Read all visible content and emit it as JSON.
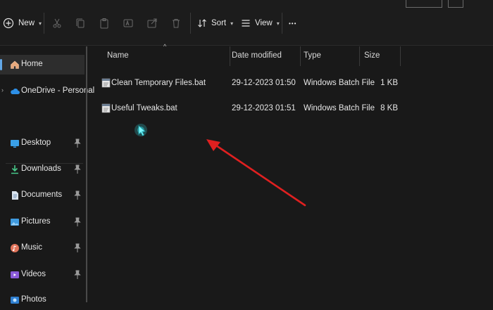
{
  "toolbar": {
    "new_label": "New",
    "sort_label": "Sort",
    "view_label": "View",
    "more_label": "•••"
  },
  "sidebar": {
    "items": [
      {
        "label": "Home",
        "icon": "home-icon"
      },
      {
        "label": "OneDrive - Personal",
        "icon": "cloud-icon"
      },
      {
        "label": "Desktop",
        "icon": "desktop-icon"
      },
      {
        "label": "Downloads",
        "icon": "download-icon"
      },
      {
        "label": "Documents",
        "icon": "documents-icon"
      },
      {
        "label": "Pictures",
        "icon": "pictures-icon"
      },
      {
        "label": "Music",
        "icon": "music-icon"
      },
      {
        "label": "Videos",
        "icon": "videos-icon"
      },
      {
        "label": "Photos",
        "icon": "photos-icon"
      }
    ]
  },
  "columns": {
    "name": "Name",
    "date": "Date modified",
    "type": "Type",
    "size": "Size"
  },
  "files": [
    {
      "name": "Clean Temporary Files.bat",
      "date": "29-12-2023 01:50",
      "type": "Windows Batch File",
      "size": "1 KB"
    },
    {
      "name": "Useful Tweaks.bat",
      "date": "29-12-2023 01:51",
      "type": "Windows Batch File",
      "size": "8 KB"
    }
  ],
  "colors": {
    "background": "#191919",
    "accent": "#62a8e8",
    "arrow": "#e02020",
    "cursor": "#37e0e8"
  }
}
